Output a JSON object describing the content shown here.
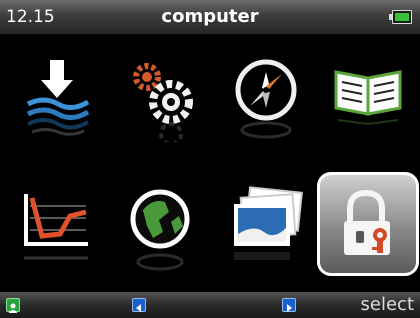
{
  "status": {
    "time": "12.15",
    "title": "computer",
    "battery_color": "#33c23a"
  },
  "grid": {
    "tiles": [
      {
        "name": "download",
        "icon": "download-waves-icon",
        "selected": false
      },
      {
        "name": "settings",
        "icon": "gears-icon",
        "selected": false
      },
      {
        "name": "compass",
        "icon": "compass-icon",
        "selected": false
      },
      {
        "name": "manual",
        "icon": "open-book-icon",
        "selected": false
      },
      {
        "name": "statistics",
        "icon": "line-chart-icon",
        "selected": false
      },
      {
        "name": "globe",
        "icon": "globe-icon",
        "selected": false
      },
      {
        "name": "photos",
        "icon": "photos-icon",
        "selected": false
      },
      {
        "name": "security",
        "icon": "padlock-key-icon",
        "selected": true
      }
    ]
  },
  "bottom": {
    "select_label": "select",
    "left_icon": "user-icon",
    "prev_icon": "arrow-left-icon",
    "next_icon": "arrow-right-icon"
  }
}
